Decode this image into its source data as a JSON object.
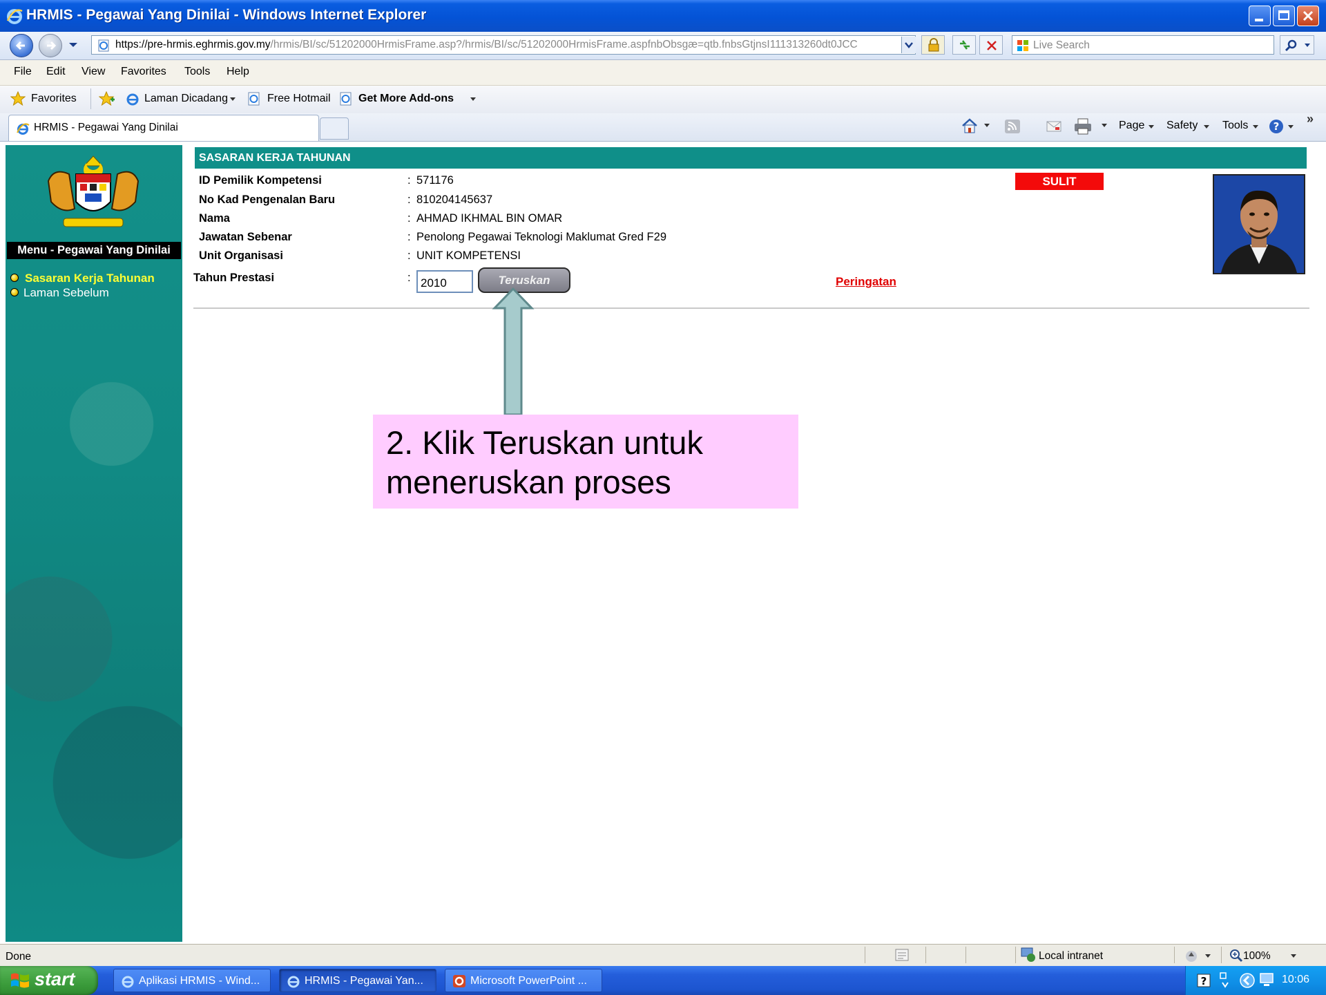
{
  "window": {
    "title": "HRMIS - Pegawai Yang Dinilai - Windows Internet Explorer"
  },
  "address_bar": {
    "url_host": "https://pre-hrmis.eghrmis.gov.my",
    "url_path": "/hrmis/BI/sc/51202000HrmisFrame.asp?/hrmis/BI/sc/51202000HrmisFrame.aspfnbObsgæ=qtb.fnbsGtjnsI111313260dt0JCC",
    "search_placeholder": "Live Search"
  },
  "menu_bar": {
    "items": [
      "File",
      "Edit",
      "View",
      "Favorites",
      "Tools",
      "Help"
    ]
  },
  "favorites_bar": {
    "favorites_label": "Favorites",
    "links": [
      "Laman Dicadang",
      "Free Hotmail",
      "Get More Add-ons"
    ]
  },
  "tab_bar": {
    "active_tab": "HRMIS - Pegawai Yang Dinilai",
    "commands": [
      "Page",
      "Safety",
      "Tools"
    ]
  },
  "sidebar": {
    "title": "Menu - Pegawai Yang Dinilai",
    "items": [
      "Sasaran Kerja Tahunan",
      "Laman Sebelum"
    ]
  },
  "main": {
    "header": "SASARAN KERJA TAHUNAN",
    "fields": [
      {
        "label": "ID Pemilik Kompetensi",
        "value": "571176"
      },
      {
        "label": "No Kad Pengenalan Baru",
        "value": "810204145637"
      },
      {
        "label": "Nama",
        "value": "AHMAD IKHMAL BIN OMAR"
      },
      {
        "label": "Jawatan Sebenar",
        "value": "Penolong Pegawai Teknologi Maklumat Gred F29"
      },
      {
        "label": "Unit Organisasi",
        "value": "UNIT KOMPETENSI"
      }
    ],
    "colon": ":",
    "tahun_label": "Tahun Prestasi",
    "tahun_value": "2010",
    "teruskan_label": "Teruskan",
    "sulit_label": "SULIT",
    "peringatan_label": "Peringatan"
  },
  "callout": {
    "line1": "2.  Klik Teruskan untuk",
    "line2": "meneruskan proses"
  },
  "status_bar": {
    "status": "Done",
    "zone": "Local intranet",
    "zoom": "100%"
  },
  "taskbar": {
    "start_label": "start",
    "tasks": [
      "Aplikasi HRMIS - Wind...",
      "HRMIS - Pegawai Yan...",
      "Microsoft PowerPoint ..."
    ],
    "clock": "10:06"
  },
  "colors": {
    "header_teal": "#0f8f89",
    "sulit_red": "#f30a0a",
    "link_red": "#e00000",
    "callout_pink": "#ffccff",
    "sidebar_link_yellow": "#ffff33"
  }
}
